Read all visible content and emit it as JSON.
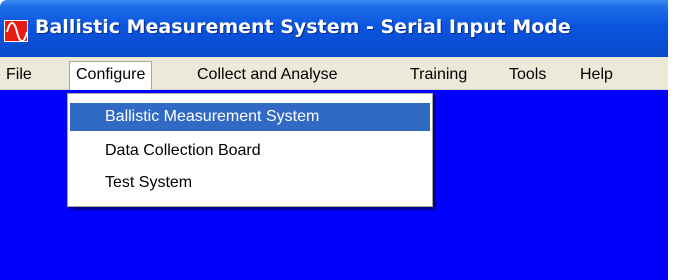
{
  "window": {
    "title": "Ballistic Measurement System - Serial Input Mode",
    "icon": "sine-wave-icon"
  },
  "menubar": {
    "items": [
      {
        "label": "File"
      },
      {
        "label": "Configure"
      },
      {
        "label": "Collect and Analyse"
      },
      {
        "label": "Training"
      },
      {
        "label": "Tools"
      },
      {
        "label": "Help"
      }
    ],
    "open_menu": "Configure"
  },
  "dropdown": {
    "items": [
      {
        "label": "Ballistic Measurement System",
        "highlighted": true
      },
      {
        "label": "Data Collection Board",
        "highlighted": false
      },
      {
        "label": "Test System",
        "highlighted": false
      }
    ]
  },
  "colors": {
    "client_background": "#0000ff",
    "title_bar": "#0a55df",
    "menu_highlight": "#316ac5",
    "menubar": "#ece9d8",
    "app_icon": "#e81c12"
  }
}
